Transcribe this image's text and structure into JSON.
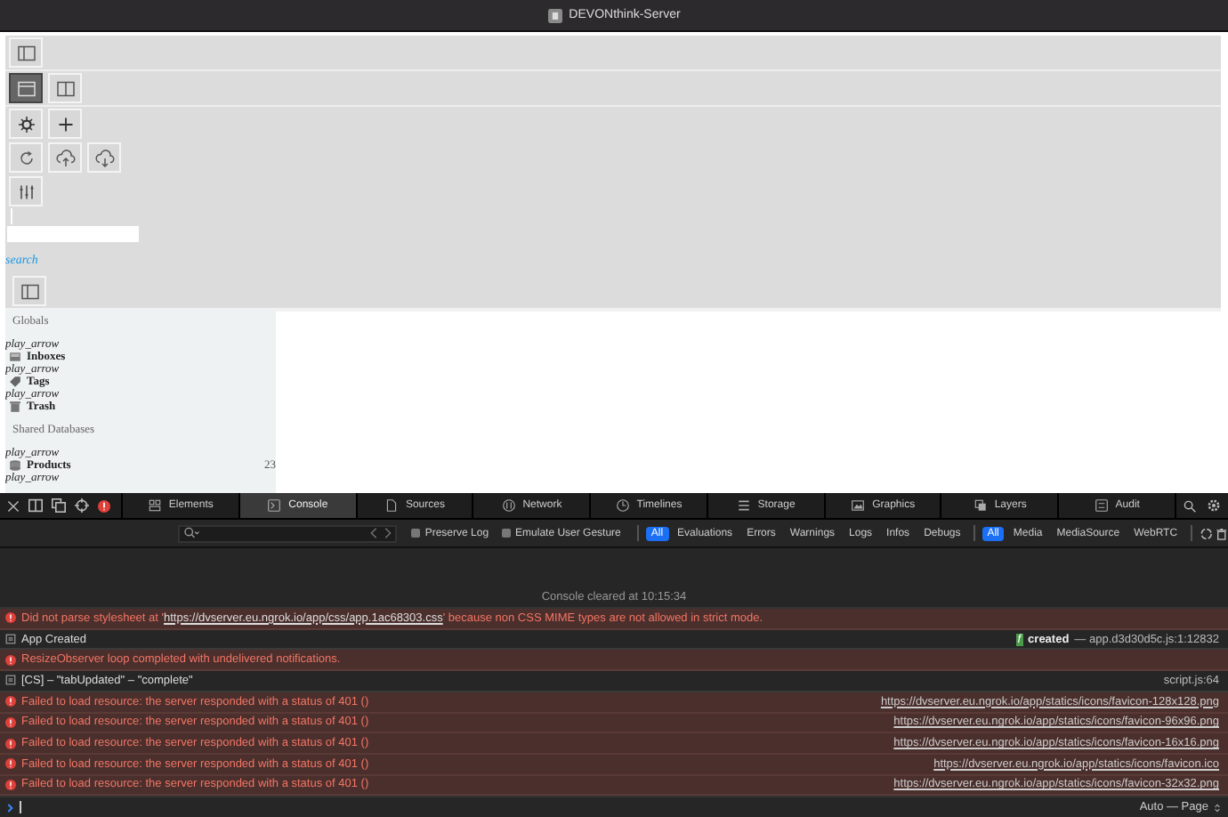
{
  "window": {
    "title": "DEVONthink-Server"
  },
  "toolbar": {
    "rows": [
      [
        {
          "selected": false
        }
      ],
      [
        {
          "selected": true
        },
        {
          "selected": false
        }
      ],
      [
        {
          "selected": false
        },
        {
          "selected": false
        }
      ],
      [
        {
          "selected": false
        },
        {
          "selected": false
        },
        {
          "selected": false
        }
      ],
      [
        {
          "selected": false
        }
      ]
    ]
  },
  "search_link": "search",
  "panel_button": {
    "selected": false
  },
  "sidebar": {
    "sections": [
      {
        "title": "Globals",
        "items": [
          {
            "toggle": "play_arrow",
            "label": "Inboxes"
          },
          {
            "toggle": "play_arrow",
            "label": "Tags"
          },
          {
            "toggle": "play_arrow",
            "label": "Trash"
          }
        ]
      },
      {
        "title": "Shared Databases",
        "items": [
          {
            "toggle": "play_arrow",
            "label": "Products",
            "count": "23"
          },
          {
            "toggle": "play_arrow"
          }
        ]
      }
    ]
  },
  "devtools": {
    "tabs": [
      {
        "label": "Elements",
        "selected": false
      },
      {
        "label": "Console",
        "selected": true
      },
      {
        "label": "Sources",
        "selected": false
      },
      {
        "label": "Network",
        "selected": false
      },
      {
        "label": "Timelines",
        "selected": false
      },
      {
        "label": "Storage",
        "selected": false
      },
      {
        "label": "Graphics",
        "selected": false
      },
      {
        "label": "Layers",
        "selected": false
      },
      {
        "label": "Audit",
        "selected": false
      }
    ],
    "checkboxes": [
      {
        "label": "Preserve Log",
        "checked": false
      },
      {
        "label": "Emulate User Gesture",
        "checked": false
      }
    ],
    "level_filters": [
      {
        "label": "All",
        "selected": true
      },
      {
        "label": "Evaluations",
        "selected": false
      },
      {
        "label": "Errors",
        "selected": false
      },
      {
        "label": "Warnings",
        "selected": false
      },
      {
        "label": "Logs",
        "selected": false
      },
      {
        "label": "Infos",
        "selected": false
      },
      {
        "label": "Debugs",
        "selected": false
      }
    ],
    "source_filters": [
      {
        "label": "All",
        "selected": true
      },
      {
        "label": "Media",
        "selected": false
      },
      {
        "label": "MediaSource",
        "selected": false
      },
      {
        "label": "WebRTC",
        "selected": false
      }
    ],
    "cleared": "Console cleared at 10:15:34",
    "messages": [
      {
        "kind": "error",
        "text": "Did not parse stylesheet at '",
        "link": "https://dvserver.eu.ngrok.io/app/css/app.1ac68303.css",
        "text_after": "' because non CSS MIME types are not allowed in strict mode."
      },
      {
        "kind": "log",
        "text": "App Created",
        "badge": "f",
        "source_label": "created",
        "source": "— app.d3d30d5c.js:1:12832"
      },
      {
        "kind": "error",
        "text": "ResizeObserver loop completed with undelivered notifications."
      },
      {
        "kind": "log",
        "text": "[CS] – \"tabUpdated\" – \"complete\"",
        "source": "script.js:64"
      },
      {
        "kind": "error",
        "text": "Failed to load resource: the server responded with a status of 401 ()",
        "source_link": "https://dvserver.eu.ngrok.io/app/statics/icons/favicon-128x128.png"
      },
      {
        "kind": "error",
        "text": "Failed to load resource: the server responded with a status of 401 ()",
        "source_link": "https://dvserver.eu.ngrok.io/app/statics/icons/favicon-96x96.png"
      },
      {
        "kind": "error",
        "text": "Failed to load resource: the server responded with a status of 401 ()",
        "source_link": "https://dvserver.eu.ngrok.io/app/statics/icons/favicon-16x16.png"
      },
      {
        "kind": "error",
        "text": "Failed to load resource: the server responded with a status of 401 ()",
        "source_link": "https://dvserver.eu.ngrok.io/app/statics/icons/favicon.ico"
      },
      {
        "kind": "error",
        "text": "Failed to load resource: the server responded with a status of 401 ()",
        "source_link": "https://dvserver.eu.ngrok.io/app/statics/icons/favicon-32x32.png"
      }
    ],
    "context": "Auto — Page"
  }
}
